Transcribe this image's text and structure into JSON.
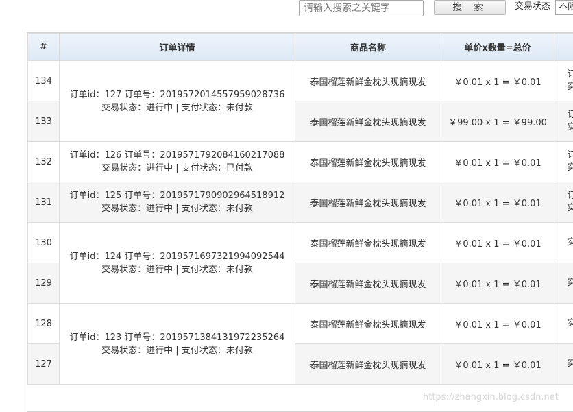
{
  "search": {
    "placeholder": "请输入搜索之关键字",
    "button_label": "搜 索"
  },
  "filter": {
    "label": "交易状态",
    "selected": "不限"
  },
  "table": {
    "headers": [
      "#",
      "订单详情",
      "商品名称",
      "单价x数量=总价",
      ""
    ],
    "rows": [
      {
        "id": "134",
        "product": "泰国榴莲新鲜金枕头现摘现发",
        "price": "￥0.01 x 1 = ￥0.01",
        "extra1": "订单",
        "extra2": "实付"
      },
      {
        "id": "133",
        "product": "泰国榴莲新鲜金枕头现摘现发",
        "price": "￥99.00 x 1 = ￥99.00",
        "extra1": "订单",
        "extra2": "实付"
      },
      {
        "id": "132",
        "product": "泰国榴莲新鲜金枕头现摘现发",
        "price": "￥0.01 x 1 = ￥0.01",
        "extra1": "订单",
        "extra2": "实付"
      },
      {
        "id": "131",
        "product": "泰国榴莲新鲜金枕头现摘现发",
        "price": "￥0.01 x 1 = ￥0.01",
        "extra1": "订单",
        "extra2": "实付"
      },
      {
        "id": "130",
        "product": "泰国榴莲新鲜金枕头现摘现发",
        "price": "￥0.01 x 1 = ￥0.01",
        "extra1": "",
        "extra2": "实付"
      },
      {
        "id": "129",
        "product": "泰国榴莲新鲜金枕头现摘现发",
        "price": "￥0.01 x 1 = ￥0.01",
        "extra1": "",
        "extra2": "实付"
      },
      {
        "id": "128",
        "product": "泰国榴莲新鲜金枕头现摘现发",
        "price": "￥0.01 x 1 = ￥0.01",
        "extra1": "",
        "extra2": "实付"
      },
      {
        "id": "127",
        "product": "泰国榴莲新鲜金枕头现摘现发",
        "price": "￥0.01 x 1 = ￥0.01",
        "extra1": "",
        "extra2": "实付"
      }
    ],
    "orders": [
      {
        "line1": "订单id：127 订单号：2019572014557959028736",
        "line2": "交易状态：进行中 | 支付状态：未付款"
      },
      {
        "line1": "订单id：126 订单号：2019571792084160217088",
        "line2": "交易状态：进行中 | 支付状态：已付款"
      },
      {
        "line1": "订单id：125 订单号：2019571790902964518912",
        "line2": "交易状态：进行中 | 支付状态：未付款"
      },
      {
        "line1": "订单id：124 订单号：2019571697321994092544",
        "line2": "交易状态：进行中 | 支付状态：未付款"
      },
      {
        "line1": "订单id：123 订单号：2019571384131972235264",
        "line2": "交易状态：进行中 | 支付状态：未付款"
      }
    ]
  },
  "watermark": "https://zhangxin.blog.csdn.net"
}
